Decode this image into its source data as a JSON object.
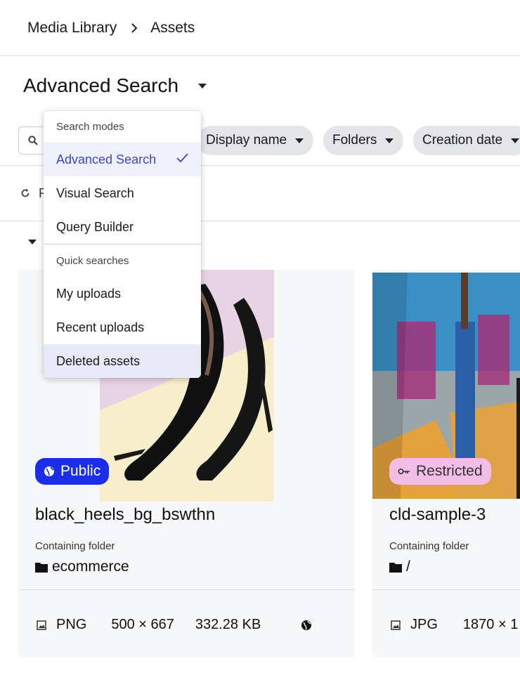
{
  "breadcrumb": {
    "root": "Media Library",
    "current": "Assets"
  },
  "page": {
    "title": "Advanced Search"
  },
  "filters": {
    "search_placeholder": "",
    "chips": [
      "Display name",
      "Folders",
      "Creation date"
    ]
  },
  "toolbar": {
    "refresh_partial": "R"
  },
  "menu": {
    "modes_title": "Search modes",
    "modes": [
      "Advanced Search",
      "Visual Search",
      "Query Builder"
    ],
    "selected_mode": "Advanced Search",
    "quick_title": "Quick searches",
    "quick": [
      "My uploads",
      "Recent uploads",
      "Deleted assets"
    ]
  },
  "assets": [
    {
      "access": "Public",
      "name": "black_heels_bg_bswthn",
      "folder_label": "Containing folder",
      "folder": "ecommerce",
      "format": "PNG",
      "dimensions": "500 × 667",
      "size": "332.28 KB"
    },
    {
      "access": "Restricted",
      "name": "cld-sample-3",
      "folder_label": "Containing folder",
      "folder": "/",
      "format": "JPG",
      "dimensions": "1870 × 1"
    }
  ],
  "colors": {
    "accent": "#3d47c4",
    "public_badge": "#1a2ee8",
    "restricted_badge": "#f2bde6",
    "card_bg": "#f6f7f9"
  }
}
